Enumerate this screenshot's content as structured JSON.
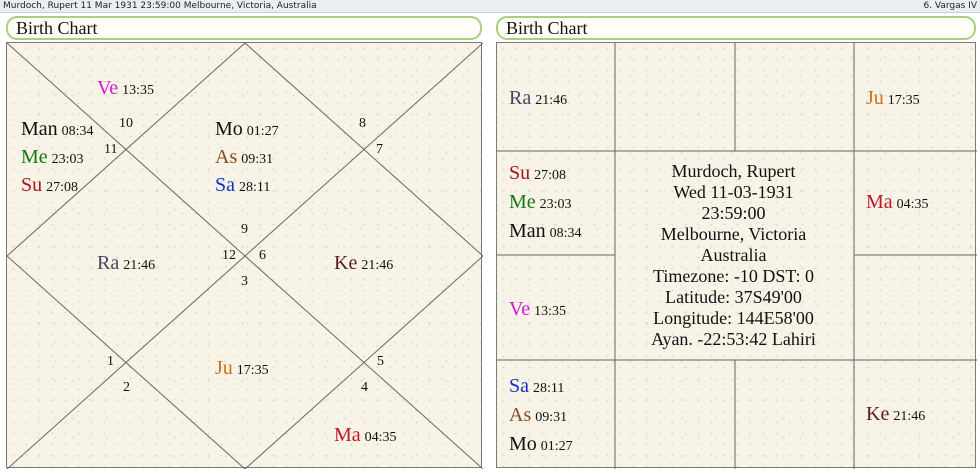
{
  "titlebar": {
    "left": "Murdoch, Rupert 11 Mar 1931 23:59:00  Melbourne, Victoria, Australia",
    "right": "6. Vargas IV"
  },
  "left_chart": {
    "title": "Birth Chart",
    "house_numbers": {
      "n10": "10",
      "n11": "11",
      "n8": "8",
      "n7": "7",
      "n9": "9",
      "n12": "12",
      "n6": "6",
      "n3": "3",
      "n1": "1",
      "n2": "2",
      "n5": "5",
      "n4": "4"
    },
    "planets": {
      "ve": {
        "name": "Ve",
        "deg": "13:35"
      },
      "man": {
        "name": "Man",
        "deg": "08:34"
      },
      "me": {
        "name": "Me",
        "deg": "23:03"
      },
      "su": {
        "name": "Su",
        "deg": "27:08"
      },
      "mo": {
        "name": "Mo",
        "deg": "01:27"
      },
      "as": {
        "name": "As",
        "deg": "09:31"
      },
      "sa": {
        "name": "Sa",
        "deg": "28:11"
      },
      "ra": {
        "name": "Ra",
        "deg": "21:46"
      },
      "ke": {
        "name": "Ke",
        "deg": "21:46"
      },
      "ju": {
        "name": "Ju",
        "deg": "17:35"
      },
      "ma": {
        "name": "Ma",
        "deg": "04:35"
      }
    }
  },
  "right_chart": {
    "title": "Birth Chart",
    "planets": {
      "ra": {
        "name": "Ra",
        "deg": "21:46"
      },
      "ju": {
        "name": "Ju",
        "deg": "17:35"
      },
      "su": {
        "name": "Su",
        "deg": "27:08"
      },
      "me": {
        "name": "Me",
        "deg": "23:03"
      },
      "man": {
        "name": "Man",
        "deg": "08:34"
      },
      "ma": {
        "name": "Ma",
        "deg": "04:35"
      },
      "ve": {
        "name": "Ve",
        "deg": "13:35"
      },
      "sa": {
        "name": "Sa",
        "deg": "28:11"
      },
      "as": {
        "name": "As",
        "deg": "09:31"
      },
      "mo": {
        "name": "Mo",
        "deg": "01:27"
      },
      "ke": {
        "name": "Ke",
        "deg": "21:46"
      }
    },
    "info": {
      "name": "Murdoch, Rupert",
      "date": "Wed 11-03-1931",
      "time": "23:59:00",
      "place": "Melbourne, Victoria",
      "country": "Australia",
      "timezone": "Timezone: -10 DST: 0",
      "latitude": "Latitude: 37S49'00",
      "longitude": "Longitude: 144E58'00",
      "ayanamsa": "Ayan. -22:53:42 Lahiri"
    }
  }
}
